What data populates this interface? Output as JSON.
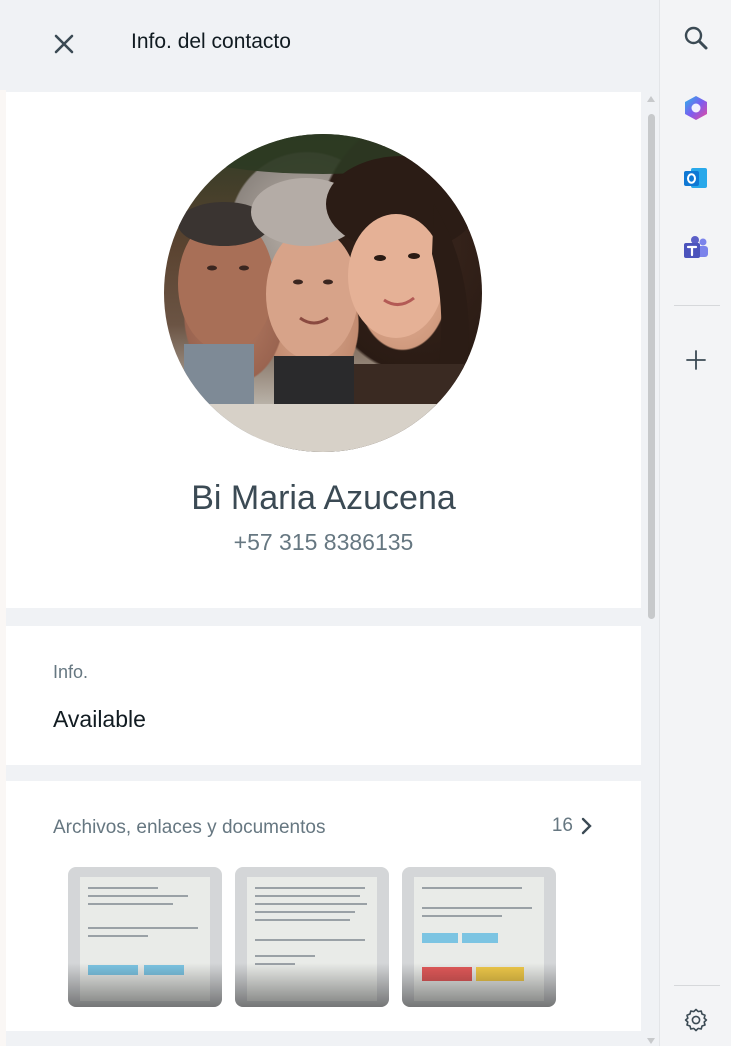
{
  "header": {
    "title": "Info. del contacto",
    "close_icon": "close-icon"
  },
  "profile": {
    "name": "Bi Maria Azucena",
    "phone": "+57 315 8386135",
    "avatar": "contact-photo"
  },
  "about": {
    "label": "Info.",
    "value": "Available"
  },
  "media": {
    "label": "Archivos, enlaces y documentos",
    "count": "16",
    "thumbnails": [
      "document-thumbnail-1",
      "document-thumbnail-2",
      "document-thumbnail-3"
    ]
  },
  "sidebar_rail": {
    "items": [
      "search-icon",
      "copilot-icon",
      "outlook-icon",
      "teams-icon",
      "add-icon"
    ],
    "footer": "settings-icon"
  },
  "colors": {
    "background": "#f0f2f5",
    "card": "#ffffff",
    "primary_text": "#111b21",
    "secondary_text": "#667781",
    "outlook_blue": "#0f78d4",
    "teams_purple": "#5b5fc7"
  }
}
